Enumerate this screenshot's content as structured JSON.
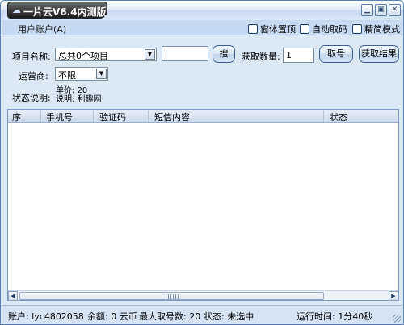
{
  "window": {
    "title": "一片云V6.4内测版",
    "controls": {
      "minimize": "▁",
      "restore": "▣",
      "close": "✕"
    }
  },
  "menubar": {
    "user_account": "用户账户(A)",
    "options": [
      {
        "label": "窗体置顶",
        "checked": false
      },
      {
        "label": "自动取码",
        "checked": false
      },
      {
        "label": "精简模式",
        "checked": false
      }
    ]
  },
  "form": {
    "project_label": "项目名称:",
    "project_value": "总共0个项目",
    "search_value": "",
    "search_button": "搜",
    "count_label": "获取数量:",
    "count_value": "1",
    "get_number_button": "取号",
    "get_result_button": "获取结果",
    "carrier_label": "运营商:",
    "carrier_value": "不限",
    "status_label": "状态说明:",
    "unit_price": "单价: 20",
    "description": "说明: 利趣网"
  },
  "table": {
    "columns": [
      "序",
      "手机号",
      "验证码",
      "短信内容",
      "状态"
    ],
    "rows": []
  },
  "statusbar": {
    "account": "账户:  lyc4802058",
    "balance": "余额:  0 云币",
    "max_numbers": "最大取号数:  20",
    "state": "状态:  未选中",
    "runtime": "运行时间:  1分40秒"
  },
  "colors": {
    "window_bg": "#dde8f5",
    "title_tab": "#3a3a3a",
    "border_accent": "#5b82b8"
  }
}
